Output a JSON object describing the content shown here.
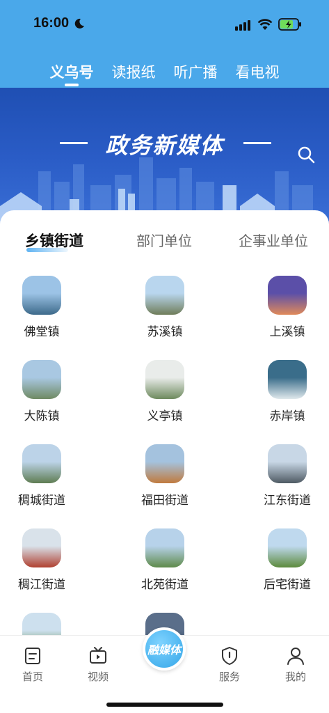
{
  "status_bar": {
    "time": "16:00"
  },
  "top_tabs": [
    {
      "label": "义乌号",
      "active": true
    },
    {
      "label": "读报纸",
      "active": false
    },
    {
      "label": "听广播",
      "active": false
    },
    {
      "label": "看电视",
      "active": false
    }
  ],
  "banner": {
    "title": "政务新媒体"
  },
  "sub_tabs": [
    {
      "label": "乡镇街道",
      "active": true
    },
    {
      "label": "部门单位",
      "active": false
    },
    {
      "label": "企事业单位",
      "active": false
    }
  ],
  "grid": [
    {
      "label": "佛堂镇",
      "colors": [
        "#9cc3e6",
        "#3d6a8a"
      ]
    },
    {
      "label": "苏溪镇",
      "colors": [
        "#b9d6ee",
        "#6f7d5a"
      ]
    },
    {
      "label": "上溪镇",
      "colors": [
        "#5b4fa8",
        "#e08a5a"
      ]
    },
    {
      "label": "大陈镇",
      "colors": [
        "#a9c8e2",
        "#6f8a63"
      ]
    },
    {
      "label": "义亭镇",
      "colors": [
        "#e9ecea",
        "#6e8a5e"
      ]
    },
    {
      "label": "赤岸镇",
      "colors": [
        "#3a6d8a",
        "#dfe8ec"
      ]
    },
    {
      "label": "稠城街道",
      "colors": [
        "#bcd3e8",
        "#5e7c52"
      ]
    },
    {
      "label": "福田街道",
      "colors": [
        "#a4c2de",
        "#c07a3e"
      ]
    },
    {
      "label": "江东街道",
      "colors": [
        "#c8d7e6",
        "#4e5a63"
      ]
    },
    {
      "label": "稠江街道",
      "colors": [
        "#d9e2ea",
        "#b04030"
      ]
    },
    {
      "label": "北苑街道",
      "colors": [
        "#b7d2ea",
        "#5e8a4a"
      ]
    },
    {
      "label": "后宅街道",
      "colors": [
        "#bfd9ee",
        "#5c8a3c"
      ]
    },
    {
      "label": "",
      "colors": [
        "#cde0ee",
        "#5e8a4a"
      ]
    },
    {
      "label": "",
      "colors": [
        "#5a6e8a",
        "#3a4a5e"
      ]
    }
  ],
  "bottom_nav": {
    "items": [
      {
        "label": "首页",
        "icon": "home-doc-icon"
      },
      {
        "label": "视频",
        "icon": "tv-icon"
      },
      {
        "label": "服务",
        "icon": "shield-icon"
      },
      {
        "label": "我的",
        "icon": "person-icon"
      }
    ],
    "center_label": "融媒体"
  },
  "colors": {
    "header_blue": "#4aa8ea",
    "banner_blue": "#1f4fb3",
    "accent": "#34a6e8"
  }
}
